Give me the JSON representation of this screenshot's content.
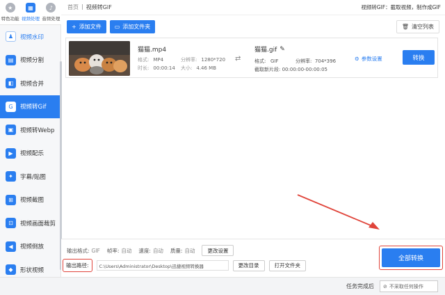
{
  "top_tabs": [
    {
      "label": "特色功能",
      "icon": "star-icon"
    },
    {
      "label": "视频处理",
      "icon": "film-icon"
    },
    {
      "label": "音频处理",
      "icon": "music-icon"
    }
  ],
  "sidebar": {
    "items": [
      {
        "label": "视频水印"
      },
      {
        "label": "视频分割"
      },
      {
        "label": "视频合并"
      },
      {
        "label": "视频转Gif"
      },
      {
        "label": "视频转Webp"
      },
      {
        "label": "视频配乐"
      },
      {
        "label": "字幕/贴图"
      },
      {
        "label": "视频截图"
      },
      {
        "label": "视频画面裁剪"
      },
      {
        "label": "视频倒放"
      },
      {
        "label": "形状视频"
      }
    ],
    "active_index": 3
  },
  "header": {
    "home": "首页",
    "separator": "|",
    "current": "视频转GIF",
    "hint": "视频转GIF：截取视频，制作成GIF"
  },
  "toolbar": {
    "add_file": "添加文件",
    "add_folder": "添加文件夹",
    "clear_list": "清空列表"
  },
  "file": {
    "name": "猫猫.mp4",
    "format_label": "格式:",
    "format": "MP4",
    "resolution_label": "分辨率:",
    "resolution": "1280*720",
    "duration_label": "时长:",
    "duration": "00:00:14",
    "size_label": "大小:",
    "size": "4.46 MB",
    "out_name": "猫猫.gif",
    "out_format_label": "格式:",
    "out_format": "GIF",
    "out_resolution_label": "分辨率:",
    "out_resolution": "704*396",
    "clip_label": "截取新片段:",
    "clip": "00:00:00-00:00:05",
    "param_settings": "参数设置",
    "convert": "转换"
  },
  "settings": {
    "out_format_label": "输出格式:",
    "out_format": "GIF",
    "fps_label": "帧率:",
    "fps": "自动",
    "speed_label": "速度:",
    "speed": "自动",
    "quality_label": "质量:",
    "quality": "自动",
    "change_settings": "更改设置",
    "out_path_label": "输出路径:",
    "out_path": "C:\\Users\\Administrator\\Desktop\\迅捷视频转换器",
    "change_dir": "更改目录",
    "open_folder": "打开文件夹",
    "convert_all": "全部转换"
  },
  "status": {
    "after_label": "任务完成后",
    "after_value": "不采取任何操作"
  },
  "colors": {
    "accent": "#2a7ef0",
    "highlight": "#e0443a"
  }
}
